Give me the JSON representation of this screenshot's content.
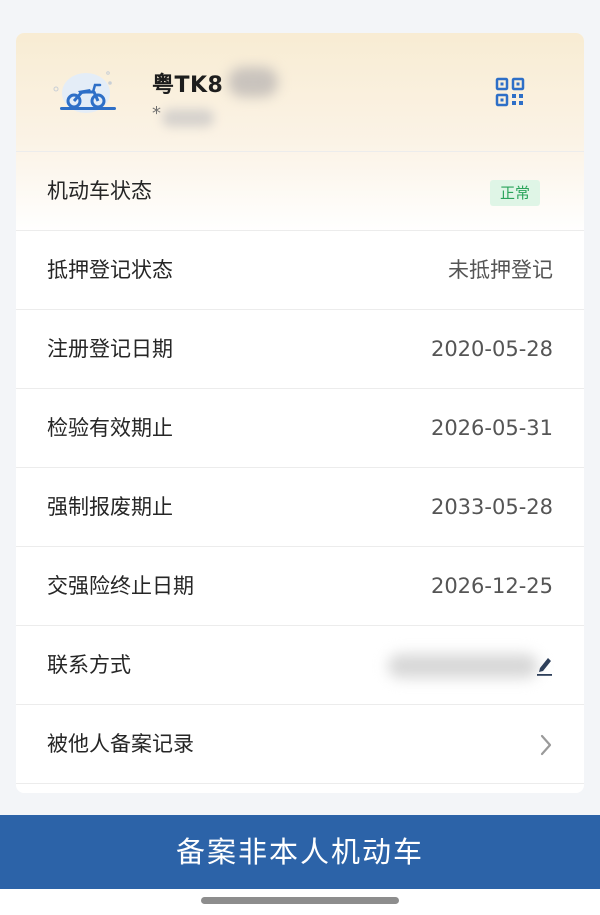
{
  "vehicle": {
    "plate_visible": "粤TK8",
    "owner_visible": "*"
  },
  "rows": [
    {
      "label": "机动车状态",
      "value": "正常"
    },
    {
      "label": "抵押登记状态",
      "value": "未抵押登记"
    },
    {
      "label": "注册登记日期",
      "value": "2020-05-28"
    },
    {
      "label": "检验有效期止",
      "value": "2026-05-31"
    },
    {
      "label": "强制报废期止",
      "value": "2033-05-28"
    },
    {
      "label": "交强险终止日期",
      "value": "2026-12-25"
    },
    {
      "label": "联系方式",
      "value": ""
    },
    {
      "label": "被他人备案记录",
      "value": ""
    }
  ],
  "action": {
    "label": "备案非本人机动车"
  },
  "icons": {
    "vehicle": "motorcycle-icon",
    "qr": "qr-code-icon",
    "edit": "edit-icon",
    "chevron": "chevron-right-icon"
  },
  "colors": {
    "accent_blue": "#2c63a8",
    "icon_blue": "#2e6fc7",
    "status_green": "#2aa45a",
    "status_bg": "#dff5e6",
    "header_warm": "#f8ecd3"
  }
}
